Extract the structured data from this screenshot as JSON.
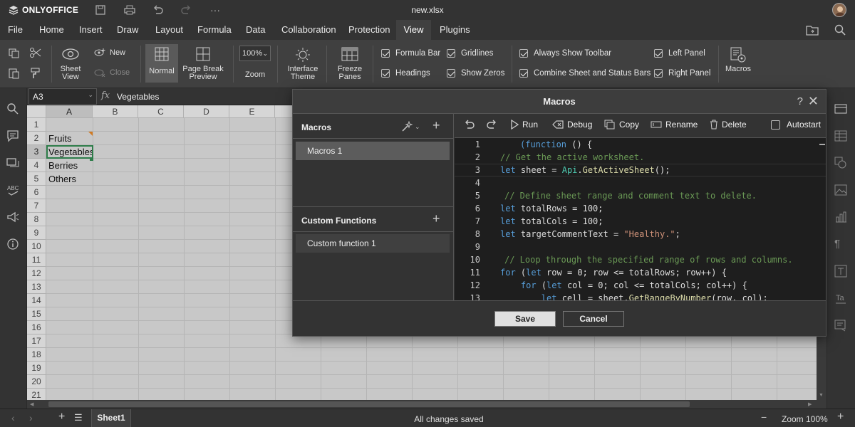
{
  "app": {
    "name": "ONLYOFFICE",
    "file_name": "new.xlsx"
  },
  "menu": [
    "File",
    "Home",
    "Insert",
    "Draw",
    "Layout",
    "Formula",
    "Data",
    "Collaboration",
    "Protection",
    "View",
    "Plugins"
  ],
  "active_menu": "View",
  "toolbar": {
    "new": "New",
    "close": "Close",
    "sheet_view": "Sheet View",
    "normal": "Normal",
    "page_break": "Page Break Preview",
    "zoom_value": "100%",
    "zoom": "Zoom",
    "interface_theme": "Interface Theme",
    "freeze_panes": "Freeze Panes",
    "formula_bar": "Formula Bar",
    "gridlines": "Gridlines",
    "headings": "Headings",
    "show_zeros": "Show Zeros",
    "always_show_toolbar": "Always Show Toolbar",
    "combine_bars": "Combine Sheet and Status Bars",
    "left_panel": "Left Panel",
    "right_panel": "Right Panel",
    "macros": "Macros"
  },
  "formula_bar": {
    "cell_ref": "A3",
    "fx": "fx",
    "value": "Vegetables"
  },
  "columns": [
    "A",
    "B",
    "C",
    "D",
    "E"
  ],
  "rows": [
    "1",
    "2",
    "3",
    "4",
    "5",
    "6",
    "7",
    "8",
    "9",
    "10",
    "11",
    "12",
    "13",
    "14",
    "15",
    "16",
    "17",
    "18",
    "19",
    "20",
    "21"
  ],
  "cells": {
    "A2": "Fruits",
    "A3": "Vegetables",
    "A4": "Berries",
    "A5": "Others"
  },
  "dialog": {
    "title": "Macros",
    "help": "?",
    "macros_title": "Macros",
    "macro_item": "Macros 1",
    "custom_title": "Custom Functions",
    "custom_item": "Custom function 1",
    "run": "Run",
    "debug": "Debug",
    "copy": "Copy",
    "rename": "Rename",
    "delete": "Delete",
    "autostart": "Autostart",
    "save": "Save",
    "cancel": "Cancel"
  },
  "code_lines": [
    "1",
    "2",
    "3",
    "4",
    "5",
    "6",
    "7",
    "8",
    "9",
    "10",
    "11",
    "12",
    "13"
  ],
  "status": {
    "saved": "All changes saved",
    "zoom": "Zoom 100%",
    "sheet": "Sheet1"
  }
}
